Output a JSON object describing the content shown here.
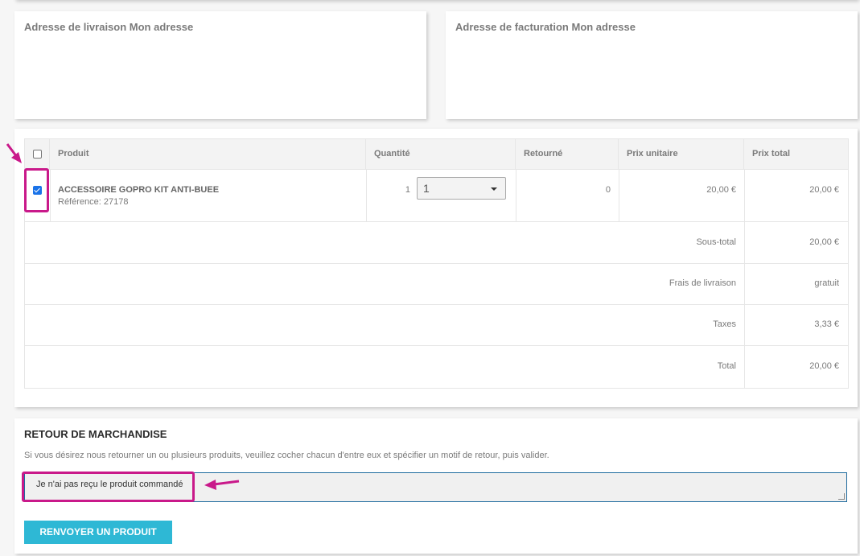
{
  "addresses": {
    "shipping_title": "Adresse de livraison Mon adresse",
    "billing_title": "Adresse de facturation Mon adresse"
  },
  "table": {
    "headers": {
      "product": "Produit",
      "quantity": "Quantité",
      "returned": "Retourné",
      "unit_price": "Prix unitaire",
      "total_price": "Prix total"
    },
    "row": {
      "checked": true,
      "name": "ACCESSOIRE GOPRO KIT ANTI-BUEE",
      "reference": "Référence: 27178",
      "quantity": "1",
      "return_qty_selected": "1",
      "returned": "0",
      "unit_price": "20,00 €",
      "total_price": "20,00 €"
    },
    "summary": [
      {
        "label": "Sous-total",
        "value": "20,00 €"
      },
      {
        "label": "Frais de livraison",
        "value": "gratuit"
      },
      {
        "label": "Taxes",
        "value": "3,33 €"
      },
      {
        "label": "Total",
        "value": "20,00 €"
      }
    ]
  },
  "return": {
    "title": "RETOUR DE MARCHANDISE",
    "instructions": "Si vous désirez nous retourner un ou plusieurs produits, veuillez cocher chacun d'entre eux et spécifier un motif de retour, puis valider.",
    "reason_value": "Je n'ai pas reçu le produit commandé",
    "submit_label": "RENVOYER UN PRODUIT"
  },
  "colors": {
    "accent": "#2eb8d5",
    "highlight": "#c9198a",
    "checkbox": "#1a73e8"
  }
}
